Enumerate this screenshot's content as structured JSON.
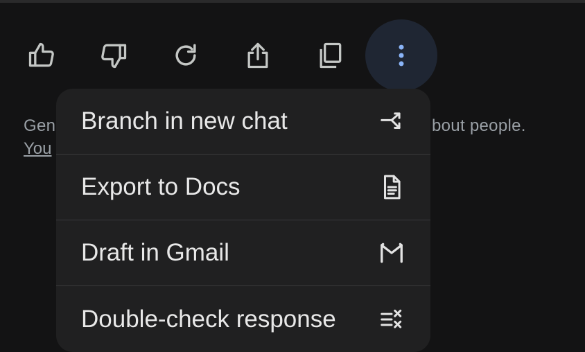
{
  "toolbar": {
    "buttons": [
      {
        "icon": "thumbs-up-icon"
      },
      {
        "icon": "thumbs-down-icon"
      },
      {
        "icon": "regenerate-icon"
      },
      {
        "icon": "share-icon"
      },
      {
        "icon": "copy-icon"
      },
      {
        "icon": "more-vertical-icon"
      }
    ]
  },
  "footer": {
    "left_text": "Gen",
    "right_text": "bout people.",
    "link_text": "You"
  },
  "menu": {
    "items": [
      {
        "label": "Branch in new chat",
        "icon": "branch-icon"
      },
      {
        "label": "Export to Docs",
        "icon": "docs-icon"
      },
      {
        "label": "Draft in Gmail",
        "icon": "gmail-icon"
      },
      {
        "label": "Double-check response",
        "icon": "double-check-icon"
      }
    ]
  },
  "colors": {
    "background": "#131314",
    "menu_bg": "#202021",
    "icon": "#c4c7c5",
    "accent": "#8ab4f8"
  }
}
